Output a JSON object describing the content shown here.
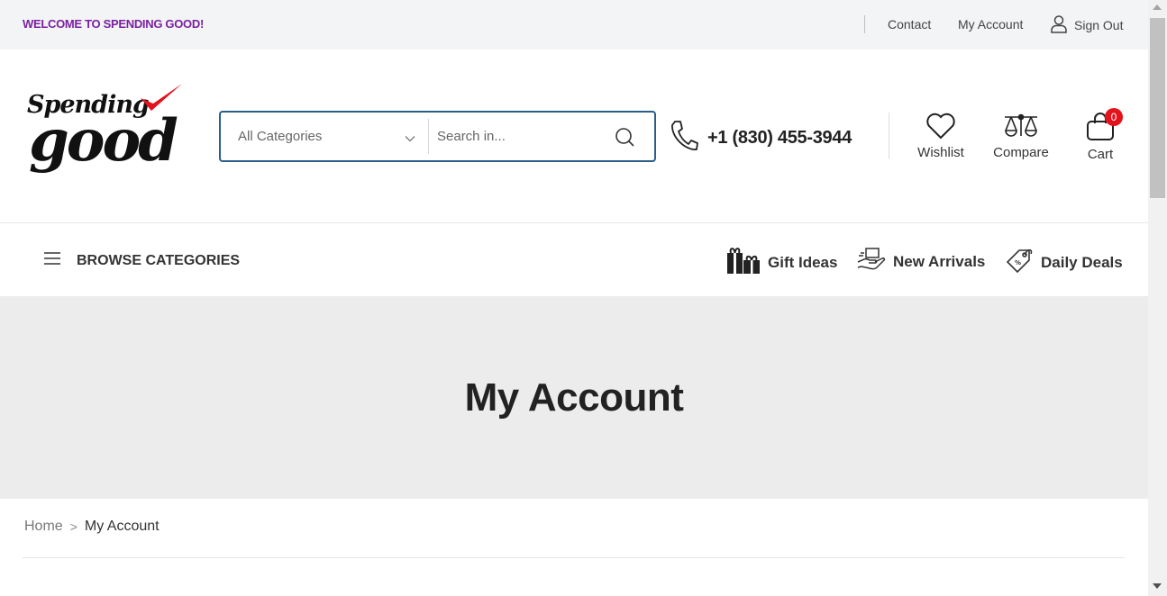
{
  "topbar": {
    "welcome": "WELCOME TO SPENDING GOOD!",
    "contact": "Contact",
    "my_account": "My Account",
    "sign_out": "Sign Out"
  },
  "logo": {
    "line1": "Spending",
    "line2": "good",
    "check_color": "#e3121c"
  },
  "search": {
    "category": "All Categories",
    "placeholder": "Search in..."
  },
  "phone": "+1 (830) 455-3944",
  "header_icons": {
    "wishlist": "Wishlist",
    "compare": "Compare",
    "cart": "Cart",
    "cart_count": "0"
  },
  "nav": {
    "browse": "BROWSE CATEGORIES",
    "gift_ideas": "Gift Ideas",
    "new_arrivals": "New Arrivals",
    "daily_deals": "Daily Deals"
  },
  "hero": {
    "title": "My Account"
  },
  "breadcrumb": {
    "home": "Home",
    "separator": ">",
    "current": "My Account"
  },
  "colors": {
    "accent_purple": "#7b1fa2",
    "search_border": "#2b5f8a",
    "badge_red": "#e3121c",
    "hero_bg": "#ececec"
  }
}
